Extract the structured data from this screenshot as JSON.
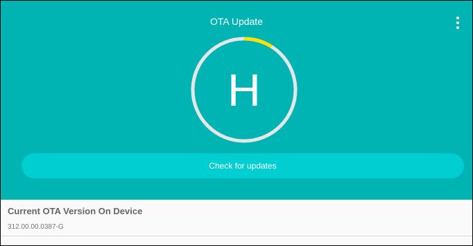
{
  "header": {
    "title": "OTA Update",
    "menu_icon": "more-vertical-icon",
    "avatar_letter": "H",
    "progress_fraction": 0.09,
    "check_button_label": "Check for updates"
  },
  "current_version": {
    "label": "Current OTA Version On Device",
    "value": "312.00.00.0387-G"
  },
  "colors": {
    "header_bg": "#00b4b4",
    "button_bg": "#00ced1",
    "progress_track": "#e6e6e6",
    "progress_fill": "#ffe100",
    "text_on_accent": "#ffffff"
  }
}
